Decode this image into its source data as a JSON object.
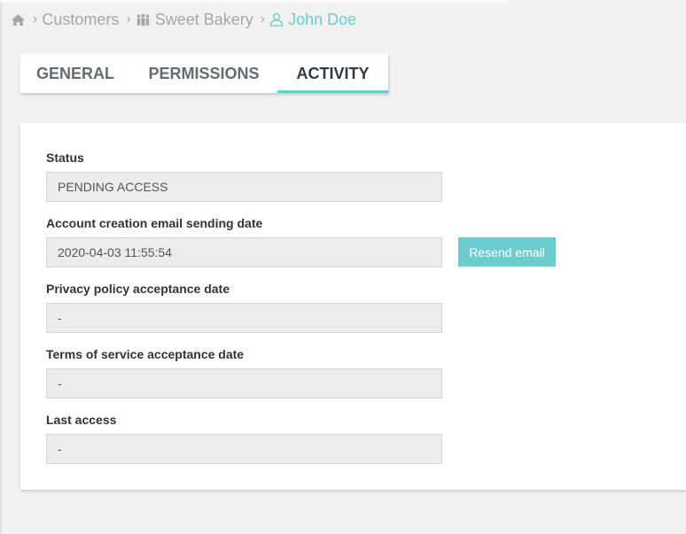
{
  "breadcrumb": {
    "home_icon": "home-icon",
    "items": [
      {
        "label": "Customers",
        "icon": ""
      },
      {
        "label": "Sweet Bakery",
        "icon": "group-icon"
      },
      {
        "label": "John Doe",
        "icon": "user-icon"
      }
    ],
    "separator": "›",
    "active_color": "#6bcbcd"
  },
  "tabs": [
    {
      "label": "GENERAL",
      "active": false
    },
    {
      "label": "PERMISSIONS",
      "active": false
    },
    {
      "label": "ACTIVITY",
      "active": true
    }
  ],
  "fields": [
    {
      "label": "Status",
      "value": "PENDING ACCESS"
    },
    {
      "label": "Account creation email sending date",
      "value": "2020-04-03 11:55:54"
    },
    {
      "label": "Privacy policy acceptance date",
      "value": "-"
    },
    {
      "label": "Terms of service acceptance date",
      "value": "-"
    },
    {
      "label": "Last access",
      "value": "-"
    }
  ],
  "resend_button": {
    "label": "Resend email"
  },
  "colors": {
    "accent": "#6bcbcd",
    "background": "#f1f1f1",
    "field_bg": "#ececec"
  }
}
